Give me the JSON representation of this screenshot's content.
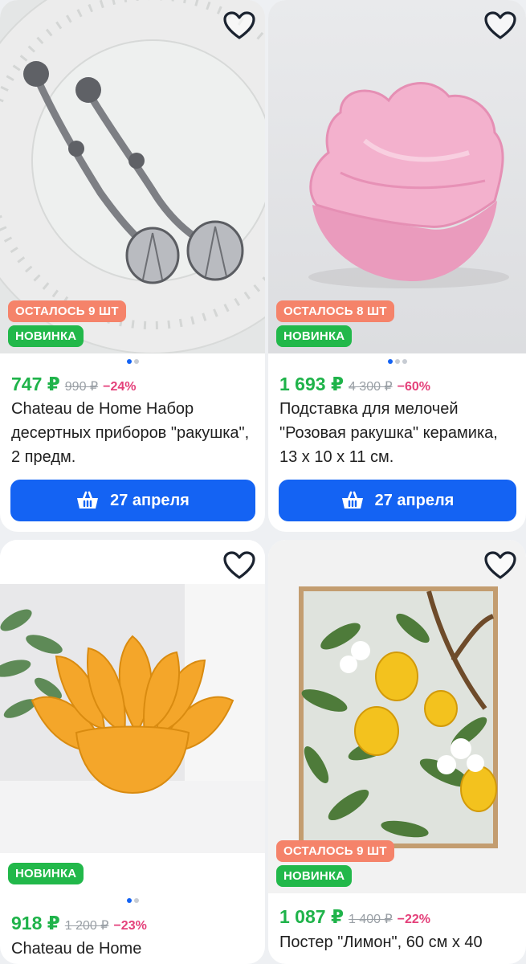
{
  "products": [
    {
      "stock_badge": "ОСТАЛОСЬ 9 ШТ",
      "new_badge": "НОВИНКА",
      "price": "747 ₽",
      "old_price": "990 ₽",
      "discount": "−24%",
      "title": "Chateau de Home Набор десертных приборов \"ракушка\", 2 предм.",
      "button": "27 апреля",
      "icon": "spoons-image"
    },
    {
      "stock_badge": "ОСТАЛОСЬ 8 ШТ",
      "new_badge": "НОВИНКА",
      "price": "1 693 ₽",
      "old_price": "4 300 ₽",
      "discount": "−60%",
      "title": "Подставка для мелочей \"Розовая ракушка\" керамика, 13 x 10 x 11 см.",
      "button": "27 апреля",
      "icon": "shell-image"
    },
    {
      "new_badge": "НОВИНКА",
      "price": "918 ₽",
      "old_price": "1 200 ₽",
      "discount": "−23%",
      "title": "Chateau de Home",
      "icon": "lotus-image"
    },
    {
      "stock_badge": "ОСТАЛОСЬ 9 ШТ",
      "new_badge": "НОВИНКА",
      "price": "1 087 ₽",
      "old_price": "1 400 ₽",
      "discount": "−22%",
      "title": "Постер \"Лимон\", 60 см x 40",
      "icon": "lemon-poster-image"
    }
  ],
  "colors": {
    "accent": "#1463f3",
    "price": "#1fb34a",
    "discount": "#e4407a",
    "badge_stock": "#f5836a",
    "badge_new": "#22b84a"
  }
}
